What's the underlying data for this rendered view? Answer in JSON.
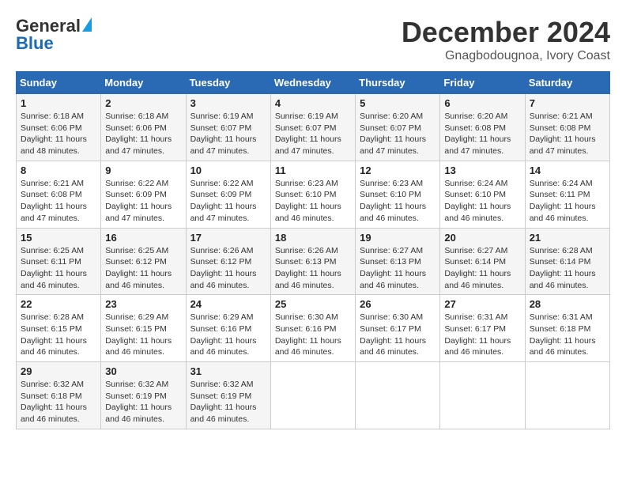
{
  "logo": {
    "general": "General",
    "blue": "Blue"
  },
  "header": {
    "month": "December 2024",
    "location": "Gnagbodougnoa, Ivory Coast"
  },
  "weekdays": [
    "Sunday",
    "Monday",
    "Tuesday",
    "Wednesday",
    "Thursday",
    "Friday",
    "Saturday"
  ],
  "weeks": [
    [
      {
        "day": "1",
        "info": "Sunrise: 6:18 AM\nSunset: 6:06 PM\nDaylight: 11 hours\nand 48 minutes."
      },
      {
        "day": "2",
        "info": "Sunrise: 6:18 AM\nSunset: 6:06 PM\nDaylight: 11 hours\nand 47 minutes."
      },
      {
        "day": "3",
        "info": "Sunrise: 6:19 AM\nSunset: 6:07 PM\nDaylight: 11 hours\nand 47 minutes."
      },
      {
        "day": "4",
        "info": "Sunrise: 6:19 AM\nSunset: 6:07 PM\nDaylight: 11 hours\nand 47 minutes."
      },
      {
        "day": "5",
        "info": "Sunrise: 6:20 AM\nSunset: 6:07 PM\nDaylight: 11 hours\nand 47 minutes."
      },
      {
        "day": "6",
        "info": "Sunrise: 6:20 AM\nSunset: 6:08 PM\nDaylight: 11 hours\nand 47 minutes."
      },
      {
        "day": "7",
        "info": "Sunrise: 6:21 AM\nSunset: 6:08 PM\nDaylight: 11 hours\nand 47 minutes."
      }
    ],
    [
      {
        "day": "8",
        "info": "Sunrise: 6:21 AM\nSunset: 6:08 PM\nDaylight: 11 hours\nand 47 minutes."
      },
      {
        "day": "9",
        "info": "Sunrise: 6:22 AM\nSunset: 6:09 PM\nDaylight: 11 hours\nand 47 minutes."
      },
      {
        "day": "10",
        "info": "Sunrise: 6:22 AM\nSunset: 6:09 PM\nDaylight: 11 hours\nand 47 minutes."
      },
      {
        "day": "11",
        "info": "Sunrise: 6:23 AM\nSunset: 6:10 PM\nDaylight: 11 hours\nand 46 minutes."
      },
      {
        "day": "12",
        "info": "Sunrise: 6:23 AM\nSunset: 6:10 PM\nDaylight: 11 hours\nand 46 minutes."
      },
      {
        "day": "13",
        "info": "Sunrise: 6:24 AM\nSunset: 6:10 PM\nDaylight: 11 hours\nand 46 minutes."
      },
      {
        "day": "14",
        "info": "Sunrise: 6:24 AM\nSunset: 6:11 PM\nDaylight: 11 hours\nand 46 minutes."
      }
    ],
    [
      {
        "day": "15",
        "info": "Sunrise: 6:25 AM\nSunset: 6:11 PM\nDaylight: 11 hours\nand 46 minutes."
      },
      {
        "day": "16",
        "info": "Sunrise: 6:25 AM\nSunset: 6:12 PM\nDaylight: 11 hours\nand 46 minutes."
      },
      {
        "day": "17",
        "info": "Sunrise: 6:26 AM\nSunset: 6:12 PM\nDaylight: 11 hours\nand 46 minutes."
      },
      {
        "day": "18",
        "info": "Sunrise: 6:26 AM\nSunset: 6:13 PM\nDaylight: 11 hours\nand 46 minutes."
      },
      {
        "day": "19",
        "info": "Sunrise: 6:27 AM\nSunset: 6:13 PM\nDaylight: 11 hours\nand 46 minutes."
      },
      {
        "day": "20",
        "info": "Sunrise: 6:27 AM\nSunset: 6:14 PM\nDaylight: 11 hours\nand 46 minutes."
      },
      {
        "day": "21",
        "info": "Sunrise: 6:28 AM\nSunset: 6:14 PM\nDaylight: 11 hours\nand 46 minutes."
      }
    ],
    [
      {
        "day": "22",
        "info": "Sunrise: 6:28 AM\nSunset: 6:15 PM\nDaylight: 11 hours\nand 46 minutes."
      },
      {
        "day": "23",
        "info": "Sunrise: 6:29 AM\nSunset: 6:15 PM\nDaylight: 11 hours\nand 46 minutes."
      },
      {
        "day": "24",
        "info": "Sunrise: 6:29 AM\nSunset: 6:16 PM\nDaylight: 11 hours\nand 46 minutes."
      },
      {
        "day": "25",
        "info": "Sunrise: 6:30 AM\nSunset: 6:16 PM\nDaylight: 11 hours\nand 46 minutes."
      },
      {
        "day": "26",
        "info": "Sunrise: 6:30 AM\nSunset: 6:17 PM\nDaylight: 11 hours\nand 46 minutes."
      },
      {
        "day": "27",
        "info": "Sunrise: 6:31 AM\nSunset: 6:17 PM\nDaylight: 11 hours\nand 46 minutes."
      },
      {
        "day": "28",
        "info": "Sunrise: 6:31 AM\nSunset: 6:18 PM\nDaylight: 11 hours\nand 46 minutes."
      }
    ],
    [
      {
        "day": "29",
        "info": "Sunrise: 6:32 AM\nSunset: 6:18 PM\nDaylight: 11 hours\nand 46 minutes."
      },
      {
        "day": "30",
        "info": "Sunrise: 6:32 AM\nSunset: 6:19 PM\nDaylight: 11 hours\nand 46 minutes."
      },
      {
        "day": "31",
        "info": "Sunrise: 6:32 AM\nSunset: 6:19 PM\nDaylight: 11 hours\nand 46 minutes."
      },
      null,
      null,
      null,
      null
    ]
  ]
}
